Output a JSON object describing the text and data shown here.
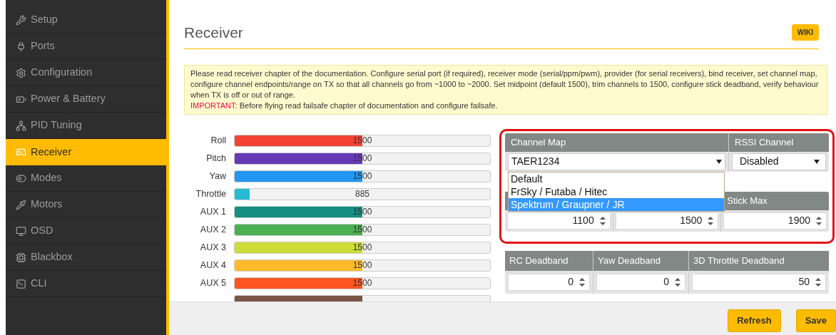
{
  "sidebar": {
    "items": [
      {
        "label": "Setup",
        "selected": false
      },
      {
        "label": "Ports",
        "selected": false
      },
      {
        "label": "Configuration",
        "selected": false
      },
      {
        "label": "Power & Battery",
        "selected": false
      },
      {
        "label": "PID Tuning",
        "selected": false
      },
      {
        "label": "Receiver",
        "selected": true
      },
      {
        "label": "Modes",
        "selected": false
      },
      {
        "label": "Motors",
        "selected": false
      },
      {
        "label": "OSD",
        "selected": false
      },
      {
        "label": "Blackbox",
        "selected": false
      },
      {
        "label": "CLI",
        "selected": false
      }
    ]
  },
  "page": {
    "title": "Receiver",
    "wiki_button": "WIKI"
  },
  "note": {
    "text": "Please read receiver chapter of the documentation. Configure serial port (if required), receiver mode (serial/ppm/pwm), provider (for serial receivers), bind receiver, set channel map, configure channel endpoints/range on TX so that all channels go from ~1000 to ~2000. Set midpoint (default 1500), trim channels to 1500, configure stick deadband, verify behaviour when TX is off or out of range.",
    "warning_label": "IMPORTANT:",
    "warning_text": "Before flying read failsafe chapter of documentation and configure failsafe."
  },
  "channels": [
    {
      "name": "Roll",
      "value": "1500",
      "level": 0.5,
      "color": "#f44336"
    },
    {
      "name": "Pitch",
      "value": "1500",
      "level": 0.5,
      "color": "#673ab7"
    },
    {
      "name": "Yaw",
      "value": "1500",
      "level": 0.5,
      "color": "#2196f3"
    },
    {
      "name": "Throttle",
      "value": "885",
      "level": 0.06,
      "color": "#26bcd7"
    },
    {
      "name": "AUX 1",
      "value": "1500",
      "level": 0.5,
      "color": "#158f82"
    },
    {
      "name": "AUX 2",
      "value": "1500",
      "level": 0.5,
      "color": "#4caf50"
    },
    {
      "name": "AUX 3",
      "value": "1500",
      "level": 0.5,
      "color": "#cddc39"
    },
    {
      "name": "AUX 4",
      "value": "1500",
      "level": 0.5,
      "color": "#fdbb2a"
    },
    {
      "name": "AUX 5",
      "value": "1500",
      "level": 0.5,
      "color": "#ff5722"
    }
  ],
  "partial_channel": {
    "level": 0.5,
    "color": "#795548"
  },
  "channel_map": {
    "header": "Channel Map",
    "value": "TAER1234",
    "options": [
      {
        "label": "Default",
        "selected": false
      },
      {
        "label": "FrSky / Futaba / Hitec",
        "selected": false
      },
      {
        "label": "Spektrum / Graupner / JR",
        "selected": true
      }
    ]
  },
  "rssi_channel": {
    "header": "RSSI Channel",
    "value": "Disabled"
  },
  "stick_table": {
    "visible_header": "Stick Max",
    "values": [
      "1100",
      "1500",
      "1900"
    ]
  },
  "deadband_table": [
    {
      "header": "RC Deadband",
      "value": "0"
    },
    {
      "header": "Yaw Deadband",
      "value": "0"
    },
    {
      "header": "3D Throttle Deadband",
      "value": "50"
    }
  ],
  "footer": {
    "buttons": [
      "Refresh",
      "Save"
    ]
  }
}
